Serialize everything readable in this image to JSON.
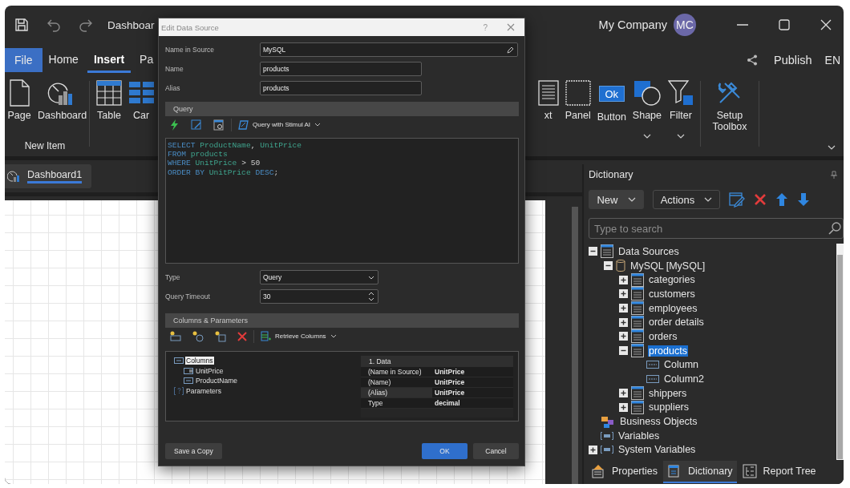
{
  "window": {
    "title": "Dashboar",
    "user": "My Company",
    "avatar": "MC"
  },
  "ribbon": {
    "tabs": [
      {
        "label": "File",
        "kind": "file",
        "selected": false
      },
      {
        "label": "Home",
        "kind": "tab",
        "selected": false
      },
      {
        "label": "Insert",
        "kind": "tab",
        "selected": true
      },
      {
        "label": "Pa",
        "kind": "tab",
        "selected": false
      }
    ],
    "publish": "Publish",
    "language": "EN",
    "groups": [
      {
        "label": "New Item",
        "items": [
          {
            "label": "Page",
            "kind": "page",
            "dropdown": false
          },
          {
            "label": "Dashboard",
            "kind": "dashboard",
            "dropdown": false
          }
        ]
      },
      {
        "items": [
          {
            "label": "Table",
            "kind": "table",
            "dropdown": false
          },
          {
            "label": "Car",
            "kind": "cards",
            "dropdown": false
          }
        ]
      },
      {
        "items": [
          {
            "label": "xt",
            "kind": "text",
            "dropdown": false
          },
          {
            "label": "Panel",
            "kind": "panel",
            "dropdown": false
          },
          {
            "label": "Button",
            "kind": "button",
            "icon_text": "Ok",
            "dropdown": false
          },
          {
            "label": "Shape",
            "kind": "shape",
            "dropdown": true
          },
          {
            "label": "Filter",
            "kind": "filter",
            "dropdown": true
          }
        ]
      },
      {
        "items": [
          {
            "label": "Setup Toolbox",
            "kind": "tools",
            "dropdown": false
          }
        ]
      }
    ]
  },
  "document_tabs": [
    {
      "label": "Dashboard1",
      "selected": true
    }
  ],
  "dictionary": {
    "title": "Dictionary",
    "new_button": "New",
    "actions_button": "Actions",
    "search_placeholder": "Type to search",
    "tree": [
      {
        "label": "Data Sources",
        "kind": "datasources",
        "expanded": true,
        "selected": false,
        "children": [
          {
            "label": "MySQL [MySQL]",
            "kind": "database",
            "expanded": true,
            "selected": false,
            "children": [
              {
                "label": "categories",
                "kind": "table",
                "expanded": false,
                "selected": false
              },
              {
                "label": "customers",
                "kind": "table",
                "expanded": false,
                "selected": false
              },
              {
                "label": "employees",
                "kind": "table",
                "expanded": false,
                "selected": false
              },
              {
                "label": "order details",
                "kind": "table",
                "expanded": false,
                "selected": false
              },
              {
                "label": "orders",
                "kind": "table",
                "expanded": false,
                "selected": false
              },
              {
                "label": "products",
                "kind": "table",
                "expanded": true,
                "selected": true,
                "children": [
                  {
                    "label": "Column",
                    "kind": "column",
                    "selected": false
                  },
                  {
                    "label": "Column2",
                    "kind": "column",
                    "selected": false
                  }
                ]
              },
              {
                "label": "shippers",
                "kind": "table",
                "expanded": false,
                "selected": false
              },
              {
                "label": "suppliers",
                "kind": "table",
                "expanded": false,
                "selected": false
              }
            ]
          }
        ]
      },
      {
        "label": "Business Objects",
        "kind": "business",
        "selected": false
      },
      {
        "label": "Variables",
        "kind": "variables",
        "selected": false
      },
      {
        "label": "System Variables",
        "kind": "sysvars",
        "expanded": false,
        "selected": false
      }
    ]
  },
  "panel_tabs": [
    {
      "label": "Properties",
      "kind": "properties",
      "selected": false
    },
    {
      "label": "Dictionary",
      "kind": "dictionary",
      "selected": true
    },
    {
      "label": "Report Tree",
      "kind": "tree",
      "selected": false
    }
  ],
  "dialog": {
    "title": "Edit Data Source",
    "help": "?",
    "fields": [
      {
        "label": "Name in Source",
        "value": "MySQL",
        "kind": "edit"
      },
      {
        "label": "Name",
        "value": "products",
        "kind": "text"
      },
      {
        "label": "Alias",
        "value": "products",
        "kind": "text"
      }
    ],
    "query_section": {
      "title": "Query",
      "ai_button": "Query with Stimul AI",
      "sql": [
        [
          {
            "t": "SELECT",
            "kind": "keyword"
          },
          {
            "t": " ProductName",
            "kind": "identifier"
          },
          {
            "t": ",",
            "kind": "plain"
          },
          {
            "t": " UnitPrice",
            "kind": "identifier"
          }
        ],
        [
          {
            "t": "FROM",
            "kind": "keyword"
          },
          {
            "t": " products",
            "kind": "identifier"
          }
        ],
        [
          {
            "t": "WHERE",
            "kind": "keyword"
          },
          {
            "t": " UnitPrice",
            "kind": "identifier"
          },
          {
            "t": " > 50",
            "kind": "plain"
          }
        ],
        [
          {
            "t": "ORDER BY",
            "kind": "keyword"
          },
          {
            "t": " UnitPrice",
            "kind": "identifier"
          },
          {
            "t": " DESC",
            "kind": "keyword"
          },
          {
            "t": ";",
            "kind": "plain"
          }
        ]
      ]
    },
    "options": [
      {
        "label": "Type",
        "value": "Query",
        "kind": "select"
      },
      {
        "label": "Query Timeout",
        "value": "30",
        "kind": "spinner"
      }
    ],
    "columns_section": {
      "title": "Columns & Parameters",
      "retrieve_button": "Retrieve Columns",
      "tree": [
        {
          "label": "Columns",
          "kind": "columns",
          "selected": true,
          "children": [
            {
              "label": "UnitPrice",
              "kind": "number",
              "selected": false
            },
            {
              "label": "ProductName",
              "kind": "string",
              "selected": false
            }
          ]
        },
        {
          "label": "Parameters",
          "kind": "parameters",
          "selected": false
        }
      ],
      "properties": {
        "category": "1. Data",
        "rows": [
          {
            "name": "(Name in Source)",
            "value": "UnitPrice",
            "selected": false
          },
          {
            "name": "(Name)",
            "value": "UnitPrice",
            "selected": false
          },
          {
            "name": "(Alias)",
            "value": "UnitPrice",
            "selected": true
          },
          {
            "name": "Type",
            "value": "decimal",
            "selected": false
          }
        ]
      }
    },
    "buttons": [
      {
        "label": "Save a Copy",
        "kind": "secondary"
      },
      {
        "label": "OK",
        "kind": "primary"
      },
      {
        "label": "Cancel",
        "kind": "secondary"
      }
    ]
  }
}
